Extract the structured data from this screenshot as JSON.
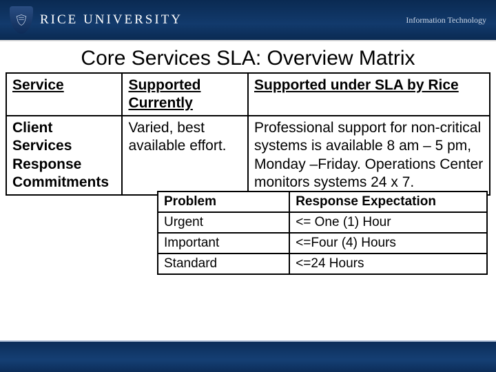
{
  "header": {
    "brand_text": "RICE UNIVERSITY",
    "it_text": "Information Technology"
  },
  "title": "Core Services SLA: Overview Matrix",
  "matrix": {
    "headers": {
      "c1": "Service",
      "c2": "Supported Currently",
      "c3": "Supported under SLA by Rice"
    },
    "row": {
      "c1": "Client Services Response Commitments",
      "c2": "Varied, best available effort.",
      "c3": "Professional support for non-critical systems is available 8 am – 5 pm, Monday –Friday. Operations Center monitors systems 24 x 7."
    }
  },
  "nested": {
    "headers": {
      "c1": "Problem",
      "c2": "Response Expectation"
    },
    "rows": [
      {
        "c1": "Urgent",
        "c2": "<= One (1) Hour"
      },
      {
        "c1": "Important",
        "c2": "<=Four (4) Hours"
      },
      {
        "c1": "Standard",
        "c2": "<=24 Hours"
      }
    ]
  }
}
